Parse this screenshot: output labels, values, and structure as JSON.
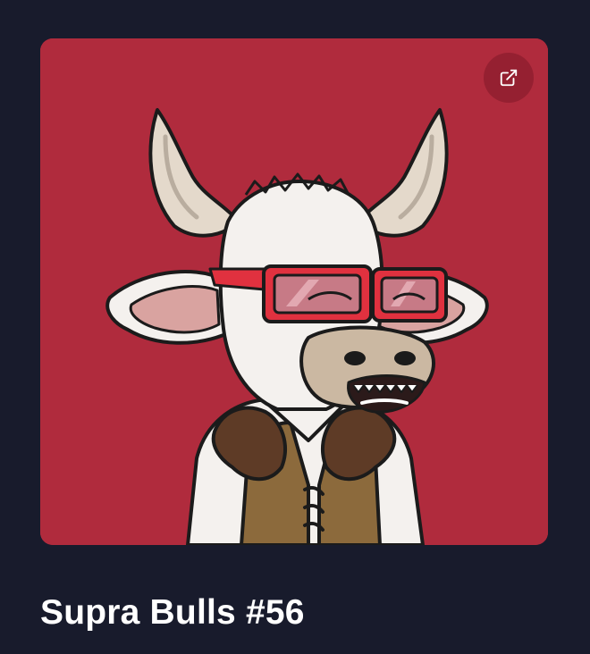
{
  "nft": {
    "title": "Supra Bulls #56",
    "image": {
      "subject": "bull-avatar",
      "background_color": "#b02b3d",
      "glasses_color": "#e0313f"
    }
  },
  "actions": {
    "external_link": {
      "icon": "external-link-icon"
    }
  },
  "colors": {
    "page_background": "#181b2c",
    "title_text": "#ffffff"
  }
}
